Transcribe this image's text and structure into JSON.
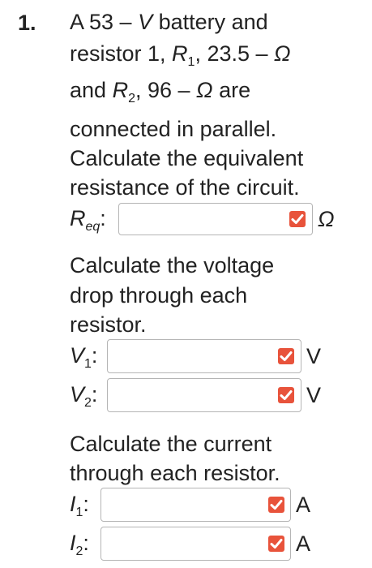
{
  "question": {
    "number": "1.",
    "line1_prefix": "A 53 – ",
    "line1_var": "V",
    "line1_suffix": " battery and",
    "line2_prefix": "resistor 1, ",
    "line2_var": "R",
    "line2_sub": "1",
    "line2_suffix": ", 23.5 – ",
    "line2_unit": "Ω",
    "line3_prefix": "and ",
    "line3_var": "R",
    "line3_sub": "2",
    "line3_mid": ", 96 – ",
    "line3_unit": "Ω",
    "line3_suffix": " are",
    "line4": "connected in parallel.",
    "line5": "Calculate the equivalent",
    "line6": "resistance of the circuit."
  },
  "req": {
    "var": "R",
    "sub": "eq",
    "colon": ":",
    "unit": "Ω",
    "value": ""
  },
  "voltage_prompt": {
    "line1": "Calculate the voltage",
    "line2": "drop through each",
    "line3": "resistor."
  },
  "v1": {
    "var": "V",
    "sub": "1",
    "colon": ":",
    "unit": "V",
    "value": ""
  },
  "v2": {
    "var": "V",
    "sub": "2",
    "colon": ":",
    "unit": "V",
    "value": ""
  },
  "current_prompt": {
    "line1": "Calculate the current",
    "line2": "through each resistor."
  },
  "i1": {
    "var": "I",
    "sub": "1",
    "colon": ":",
    "unit": "A",
    "value": ""
  },
  "i2": {
    "var": "I",
    "sub": "2",
    "colon": ":",
    "unit": "A",
    "value": ""
  },
  "colors": {
    "check_badge": "#e8533b",
    "text": "#222222",
    "field_border": "#b5b5b5"
  },
  "icons": {
    "check": "checkmark-icon"
  }
}
